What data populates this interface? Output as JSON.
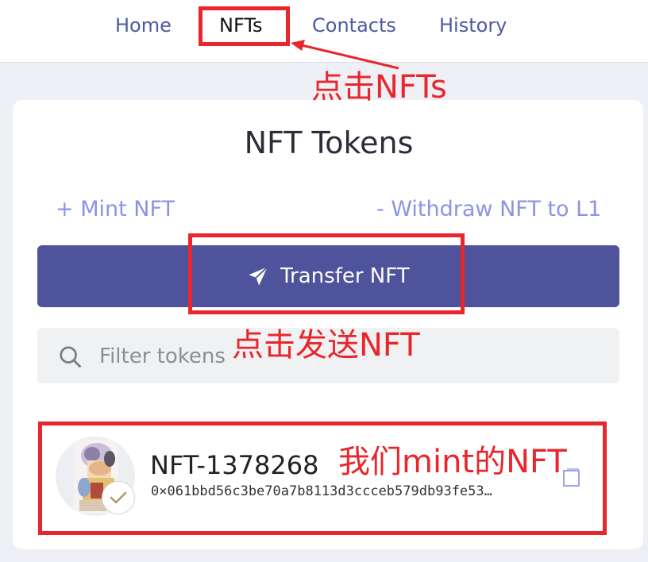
{
  "nav": {
    "items": [
      {
        "label": "Home"
      },
      {
        "label": "NFTs",
        "active": true
      },
      {
        "label": "Contacts"
      },
      {
        "label": "History"
      }
    ]
  },
  "annotations": {
    "click_nfts": "点击NFTs",
    "click_send": "点击发送NFT",
    "our_nft": "我们mint的NFT",
    "color": "#e8262b"
  },
  "page": {
    "title": "NFT Tokens",
    "mint_link": "+ Mint NFT",
    "withdraw_link": "- Withdraw NFT to L1",
    "transfer_button": "Transfer NFT",
    "transfer_icon": "send-icon"
  },
  "search": {
    "placeholder": "Filter tokens",
    "value": "",
    "icon": "search-icon"
  },
  "tokens": [
    {
      "name": "NFT-1378268",
      "address": "0×061bbd56c3be70a7b8113d3ccceb579db93fe53…",
      "verified": true
    }
  ],
  "colors": {
    "accent": "#4f539b",
    "link": "#8c93e6",
    "nav_text": "#4e5aa0",
    "background": "#eef0f5"
  }
}
